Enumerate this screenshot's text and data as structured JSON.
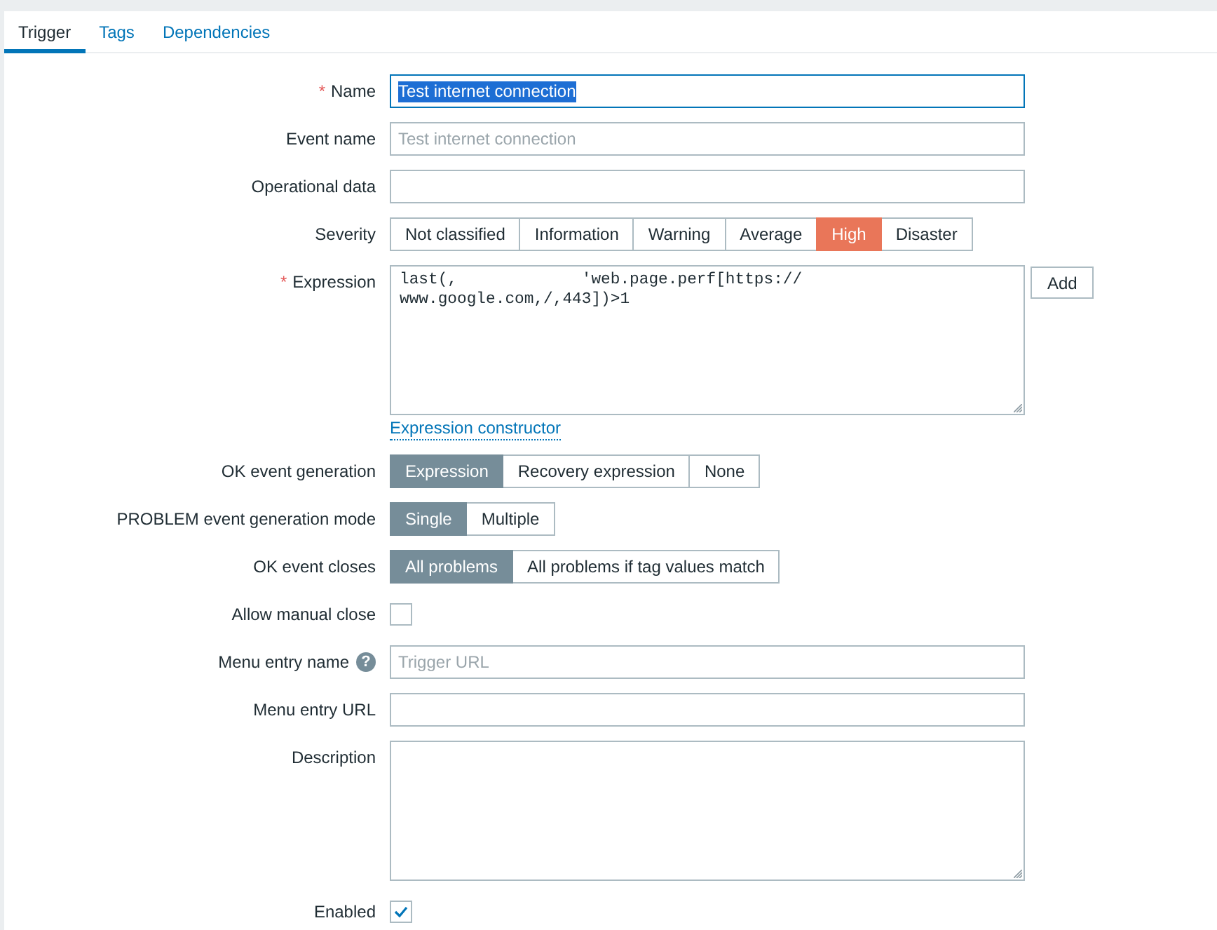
{
  "tabs": [
    {
      "label": "Trigger",
      "selected": true
    },
    {
      "label": "Tags",
      "selected": false
    },
    {
      "label": "Dependencies",
      "selected": false
    }
  ],
  "form": {
    "rows": [
      {
        "kind": "input",
        "label": "Name",
        "required_mark": "*",
        "value": "Test internet connection",
        "focused": true,
        "text_selected": true
      },
      {
        "kind": "input",
        "label": "Event name",
        "placeholder": "Test internet connection",
        "focused": false
      },
      {
        "kind": "input",
        "label": "Operational data",
        "focused": false
      },
      {
        "kind": "segmented",
        "label": "Severity",
        "options": [
          {
            "label": "Not classified",
            "selected": false
          },
          {
            "label": "Information",
            "selected": false
          },
          {
            "label": "Warning",
            "selected": false
          },
          {
            "label": "Average",
            "selected": false
          },
          {
            "label": "High",
            "selected": true,
            "color": "#e97659"
          },
          {
            "label": "Disaster",
            "selected": false
          }
        ]
      },
      {
        "kind": "expression",
        "label": "Expression",
        "required_mark": "*",
        "value": "last(,             'web.page.perf[https://\nwww.google.com,/,443])>1",
        "button": "Add",
        "link": "Expression constructor"
      },
      {
        "kind": "segmented",
        "label": "OK event generation",
        "options": [
          {
            "label": "Expression",
            "selected": true
          },
          {
            "label": "Recovery expression",
            "selected": false
          },
          {
            "label": "None",
            "selected": false
          }
        ]
      },
      {
        "kind": "segmented",
        "label": "PROBLEM event generation mode",
        "options": [
          {
            "label": "Single",
            "selected": true
          },
          {
            "label": "Multiple",
            "selected": false
          }
        ]
      },
      {
        "kind": "segmented",
        "label": "OK event closes",
        "options": [
          {
            "label": "All problems",
            "selected": true
          },
          {
            "label": "All problems if tag values match",
            "selected": false
          }
        ]
      },
      {
        "kind": "checkbox",
        "label": "Allow manual close",
        "checked": false
      },
      {
        "kind": "input",
        "label": "Menu entry name",
        "help_icon": "?",
        "placeholder": "Trigger URL",
        "focused": false
      },
      {
        "kind": "input",
        "label": "Menu entry URL",
        "focused": false
      },
      {
        "kind": "textarea",
        "label": "Description"
      },
      {
        "kind": "checkbox",
        "label": "Enabled",
        "checked": true
      }
    ]
  }
}
